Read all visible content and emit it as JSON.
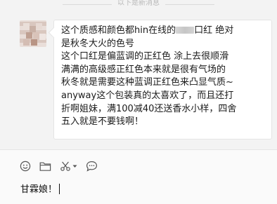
{
  "divider": {
    "text": "以下是新消息"
  },
  "message": {
    "lines": [
      "这个质感和颜色都hin在线的",
      "是秋冬大火的色号",
      "这个口红是偏蓝调的正红色 涂上去很顺滑",
      "满满的高级感正红色本来就是很有气场的",
      "秋冬就是需要这种蓝调正红色来凸显气质~",
      "anyway这个包装真的太喜欢了，而且还打",
      "折啊姐妹，满100减40还送香水小样，四舍",
      "五入就是不要钱啊！"
    ],
    "line1_suffix": "口红 绝对"
  },
  "toolbar": {
    "icons": [
      "emoji-icon",
      "folder-icon",
      "scissors-icon",
      "chevron-down-icon",
      "chat-bubble-icon"
    ]
  },
  "input": {
    "value": "甘霖娘！"
  }
}
